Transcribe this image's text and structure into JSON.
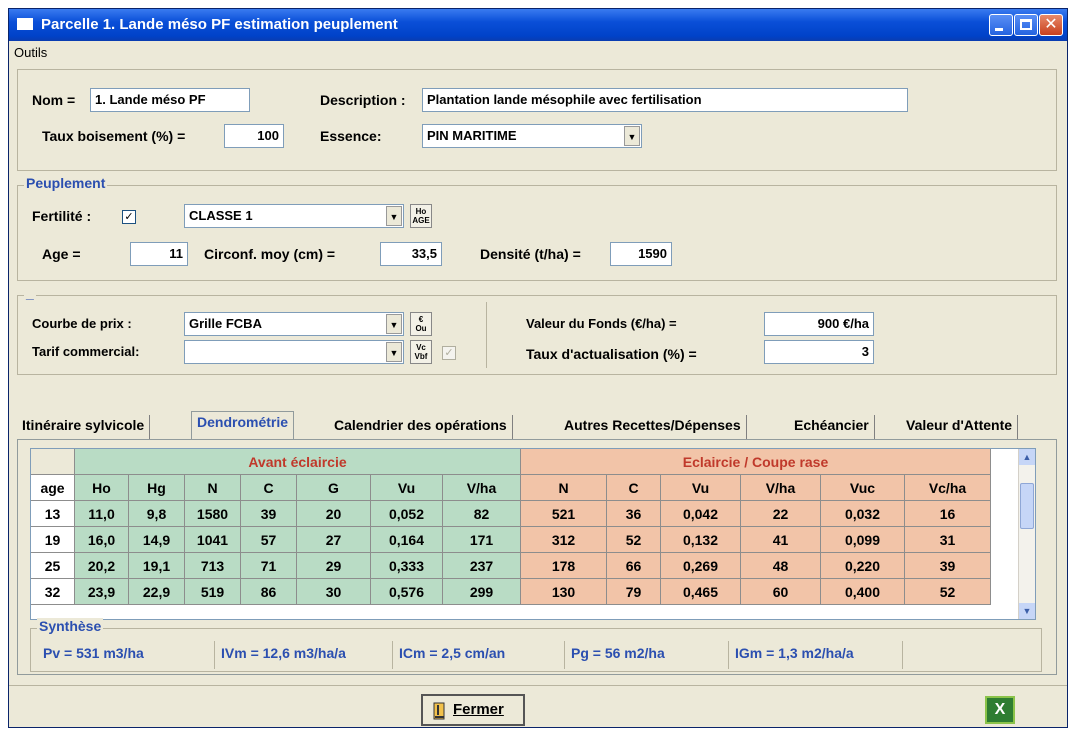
{
  "window": {
    "title": "Parcelle 1. Lande méso PF estimation peuplement"
  },
  "menu": {
    "outils": "Outils"
  },
  "header": {
    "nom_label": "Nom =",
    "nom_value": "1. Lande méso PF",
    "description_label": "Description :",
    "description_value": "Plantation lande mésophile avec fertilisation",
    "taux_label": "Taux boisement (%) =",
    "taux_value": "100",
    "essence_label": "Essence:",
    "essence_value": "PIN MARITIME"
  },
  "peuplement": {
    "group_title": "Peuplement",
    "fertilite_label": "Fertilité :",
    "fertilite_checked": "✓",
    "classe_value": "CLASSE 1",
    "ho_age_top": "Ho",
    "ho_age_bottom": "AGE",
    "age_label": "Age =",
    "age_value": "11",
    "circ_label": "Circonf. moy (cm) =",
    "circ_value": "33,5",
    "densite_label": "Densité (t/ha) =",
    "densite_value": "1590"
  },
  "prix": {
    "group_title": "_",
    "courbe_label": "Courbe de prix :",
    "courbe_value": "Grille FCBA",
    "courbe_btn_top": "€",
    "courbe_btn_bottom": "Ou",
    "tarif_label": "Tarif commercial:",
    "tarif_value": "",
    "tarif_btn_top": "Vc",
    "tarif_btn_bottom": "Vbf",
    "tarif_checked": "✓",
    "valeur_fonds_label": "Valeur du Fonds (€/ha) =",
    "valeur_fonds_value": "900 €/ha",
    "taux_act_label": "Taux d'actualisation (%) =",
    "taux_act_value": "3"
  },
  "tabs": [
    "Itinéraire sylvicole",
    "Dendrométrie",
    "Calendrier des opérations",
    "Autres Recettes/Dépenses",
    "Echéancier",
    "Valeur d'Attente"
  ],
  "table": {
    "group_avant": "Avant éclaircie",
    "group_eclaircie": "Eclaircie / Coupe rase",
    "columns": [
      "age",
      "Ho",
      "Hg",
      "N",
      "C",
      "G",
      "Vu",
      "V/ha",
      "N",
      "C",
      "Vu",
      "V/ha",
      "Vuc",
      "Vc/ha"
    ],
    "rows": [
      [
        "13",
        "11,0",
        "9,8",
        "1580",
        "39",
        "20",
        "0,052",
        "82",
        "521",
        "36",
        "0,042",
        "22",
        "0,032",
        "16"
      ],
      [
        "19",
        "16,0",
        "14,9",
        "1041",
        "57",
        "27",
        "0,164",
        "171",
        "312",
        "52",
        "0,132",
        "41",
        "0,099",
        "31"
      ],
      [
        "25",
        "20,2",
        "19,1",
        "713",
        "71",
        "29",
        "0,333",
        "237",
        "178",
        "66",
        "0,269",
        "48",
        "0,220",
        "39"
      ],
      [
        "32",
        "23,9",
        "22,9",
        "519",
        "86",
        "30",
        "0,576",
        "299",
        "130",
        "79",
        "0,465",
        "60",
        "0,400",
        "52"
      ]
    ]
  },
  "synthese": {
    "title": "Synthèse",
    "pv": "Pv  = 531 m3/ha",
    "ivm": "IVm = 12,6 m3/ha/a",
    "icm": "ICm = 2,5 cm/an",
    "pg": "Pg  = 56 m2/ha",
    "igm": "IGm = 1,3 m2/ha/a"
  },
  "footer": {
    "fermer": "Fermer",
    "excel": "X"
  },
  "colors": {
    "avant": "#b9dcc5",
    "eclaircie": "#f2c4a8",
    "avant_text": "#c0392b",
    "group_title": "#2b4fb0"
  }
}
